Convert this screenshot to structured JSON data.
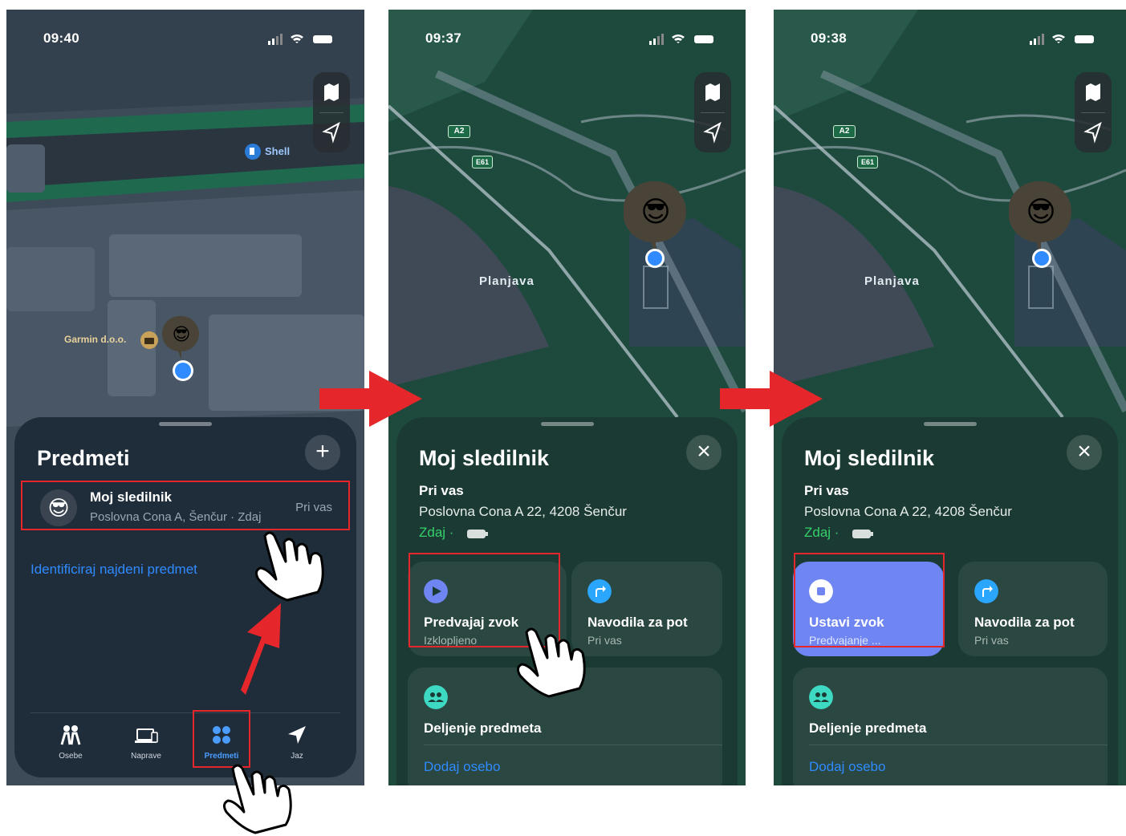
{
  "screens": [
    {
      "time": "09:40",
      "map_labels": {
        "poi_garmin": "Garmin d.o.o.",
        "poi_shell": "Shell"
      },
      "sheet": {
        "title": "Predmeti",
        "add_icon": "+",
        "item": {
          "avatar": "😎",
          "name": "Moj sledilnik",
          "subtitle": "Poslovna Cona A, Šenčur · Zdaj",
          "side": "Pri vas"
        },
        "identify_link": "Identificiraj najdeni predmet"
      },
      "tabs": [
        {
          "label": "Osebe",
          "icon": "people-icon"
        },
        {
          "label": "Naprave",
          "icon": "laptop-icon"
        },
        {
          "label": "Predmeti",
          "icon": "items-grid-icon",
          "active": true
        },
        {
          "label": "Jaz",
          "icon": "location-arrow-icon"
        }
      ]
    },
    {
      "time": "09:37",
      "map_labels": {
        "place": "Planjava",
        "road_a2": "A2",
        "road_e61": "E61"
      },
      "sheet": {
        "title": "Moj sledilnik",
        "close_icon": "×",
        "status": "Pri vas",
        "address": "Poslovna Cona A 22, 4208 Šenčur",
        "updated": "Zdaj ·",
        "play_sound": {
          "title": "Predvajaj zvok",
          "subtitle": "Izklopljeno"
        },
        "directions": {
          "title": "Navodila za pot",
          "subtitle": "Pri vas"
        },
        "sharing": {
          "title": "Deljenje predmeta",
          "link": "Dodaj osebo"
        }
      }
    },
    {
      "time": "09:38",
      "map_labels": {
        "place": "Planjava",
        "road_a2": "A2",
        "road_e61": "E61"
      },
      "sheet": {
        "title": "Moj sledilnik",
        "close_icon": "×",
        "status": "Pri vas",
        "address": "Poslovna Cona A 22, 4208 Šenčur",
        "updated": "Zdaj ·",
        "stop_sound": {
          "title": "Ustavi zvok",
          "subtitle": "Predvajanje ..."
        },
        "directions": {
          "title": "Navodila za pot",
          "subtitle": "Pri vas"
        },
        "sharing": {
          "title": "Deljenje predmeta",
          "link": "Dodaj osebo"
        }
      }
    }
  ],
  "colors": {
    "highlight": "#e5262a",
    "accent_blue": "#2f8bff",
    "active_card": "#6f86f2",
    "green": "#35d16a"
  }
}
